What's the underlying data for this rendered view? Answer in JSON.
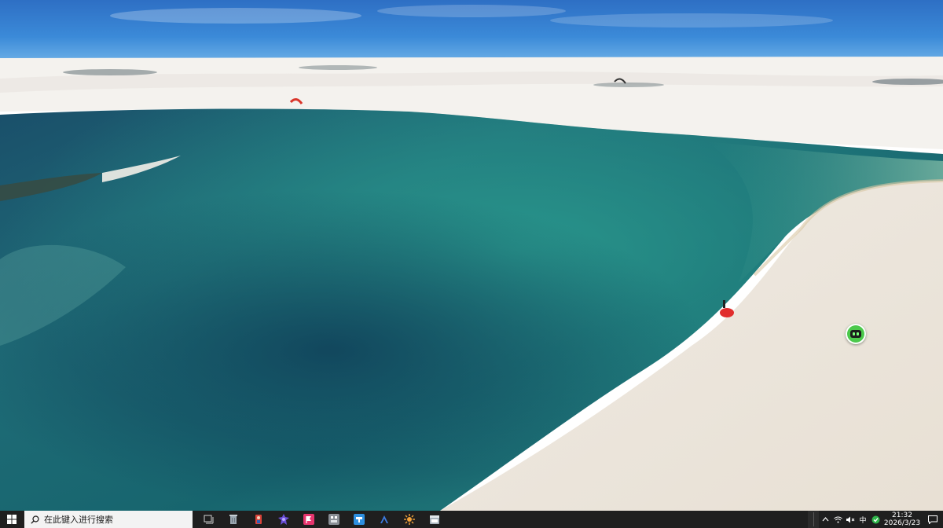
{
  "desktop": {
    "wallpaper": "aerial-lagoon-sand-dunes"
  },
  "floating_widget": {
    "icon": "robot-assistant-icon",
    "color": "#4cc94c"
  },
  "taskbar": {
    "background": "#1f1f1f",
    "start_icon": "windows-logo-icon",
    "search": {
      "placeholder": "在此键入进行搜索",
      "icon": "search-icon"
    },
    "apps": [
      {
        "name": "task-view",
        "icon": "task-view-icon",
        "color": "#d0d0d0"
      },
      {
        "name": "recycle-bin",
        "icon": "recycle-bin-icon",
        "color": "#9aa7b0"
      },
      {
        "name": "app-red-figure",
        "icon": "red-figure-icon",
        "color": "#d9443a"
      },
      {
        "name": "app-purple-gem",
        "icon": "purple-gem-icon",
        "color": "#6b4fd8"
      },
      {
        "name": "app-pink-flag",
        "icon": "pink-flag-icon",
        "color": "#e7356e"
      },
      {
        "name": "app-gray-box",
        "icon": "gray-box-icon",
        "color": "#8a8f96"
      },
      {
        "name": "app-blue-square",
        "icon": "blue-square-icon",
        "color": "#2d8fe0"
      },
      {
        "name": "app-blue-a",
        "icon": "letter-a-icon",
        "color": "#3d7be0"
      },
      {
        "name": "app-orange-flower",
        "icon": "orange-flower-icon",
        "color": "#f2a23a"
      },
      {
        "name": "app-window",
        "icon": "window-icon",
        "color": "#a9b4bd"
      }
    ],
    "tray": {
      "chevron_icon": "chevron-up-icon",
      "network_icon": "wifi-icon",
      "volume_icon": "speaker-mute-icon",
      "ime_label": "中",
      "green_app_icon": "green-shield-icon",
      "green_app_color": "#2fb54a",
      "time": "21:32",
      "date": "2026/3/23",
      "notification_icon": "notification-icon"
    }
  }
}
